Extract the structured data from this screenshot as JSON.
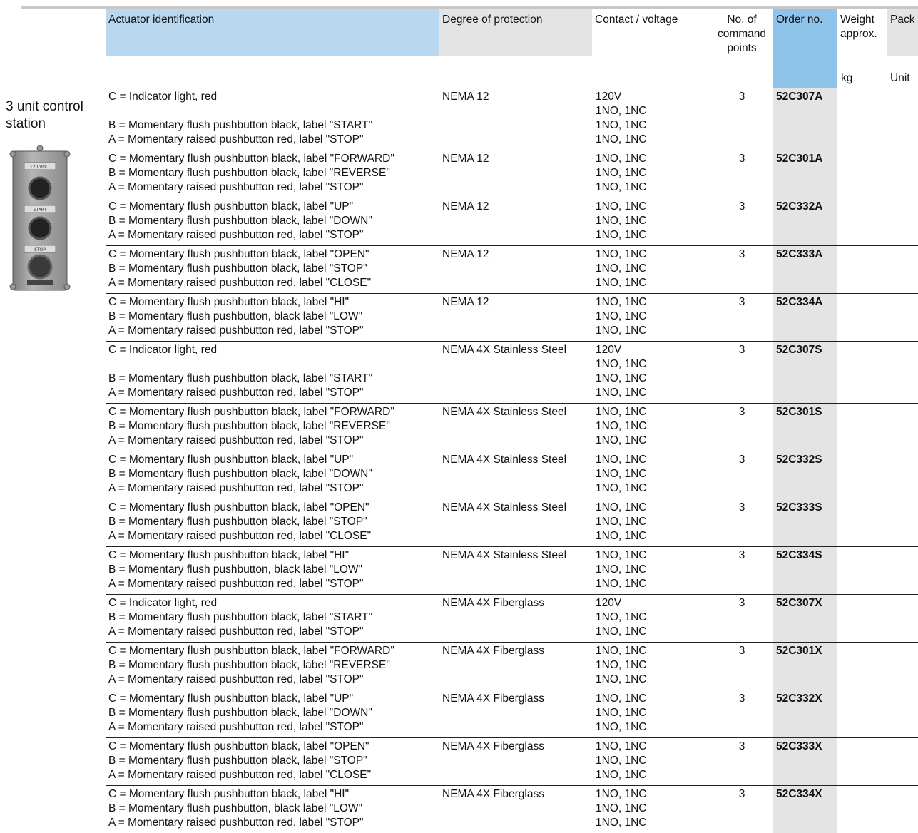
{
  "header": {
    "actuator": "Actuator identification",
    "degree": "Degree of protection",
    "contact": "Contact / voltage",
    "points": [
      "No. of",
      "command",
      "points"
    ],
    "order": "Order no.",
    "weight": [
      "Weight",
      "approx."
    ],
    "pack": "Pack",
    "kg": "kg",
    "unit": "Unit"
  },
  "section": {
    "title": [
      "3 unit control",
      "station"
    ],
    "image_name": "3-unit-control-station-photo",
    "device_labels": [
      "120 VOLT",
      "START",
      "STOP"
    ]
  },
  "rows": [
    {
      "actuator": [
        "C = Indicator light, red",
        "",
        "B = Momentary flush pushbutton black, label \"START\"",
        "A = Momentary raised pushbutton red, label \"STOP\""
      ],
      "degree": "NEMA 12",
      "contact": [
        "120V",
        "1NO, 1NC",
        "1NO, 1NC",
        "1NO, 1NC"
      ],
      "points": "3",
      "order": "52C307A"
    },
    {
      "actuator": [
        "C = Momentary flush pushbutton black, label \"FORWARD\"",
        "B = Momentary flush pushbutton black, label \"REVERSE\"",
        "A = Momentary raised pushbutton red, label \"STOP\""
      ],
      "degree": "NEMA 12",
      "contact": [
        "1NO, 1NC",
        "1NO, 1NC",
        "1NO, 1NC"
      ],
      "points": "3",
      "order": "52C301A"
    },
    {
      "actuator": [
        "C = Momentary flush pushbutton black, label \"UP\"",
        "B = Momentary flush pushbutton black, label \"DOWN\"",
        "A = Momentary raised pushbutton red, label \"STOP\""
      ],
      "degree": "NEMA 12",
      "contact": [
        "1NO, 1NC",
        "1NO, 1NC",
        "1NO, 1NC"
      ],
      "points": "3",
      "order": "52C332A"
    },
    {
      "actuator": [
        "C = Momentary flush pushbutton black, label \"OPEN\"",
        "B = Momentary flush pushbutton black, label \"STOP\"",
        "A = Momentary raised pushbutton red, label \"CLOSE\""
      ],
      "degree": "NEMA 12",
      "contact": [
        "1NO, 1NC",
        "1NO, 1NC",
        "1NO, 1NC"
      ],
      "points": "3",
      "order": "52C333A"
    },
    {
      "actuator": [
        "C = Momentary flush pushbutton black, label \"HI\"",
        "B = Momentary flush pushbutton, black label \"LOW\"",
        "A = Momentary raised pushbutton red, label \"STOP\""
      ],
      "degree": "NEMA 12",
      "contact": [
        "1NO, 1NC",
        "1NO, 1NC",
        "1NO, 1NC"
      ],
      "points": "3",
      "order": "52C334A"
    },
    {
      "actuator": [
        "C = Indicator light, red",
        "",
        "B = Momentary flush pushbutton black, label \"START\"",
        "A = Momentary raised pushbutton red, label \"STOP\""
      ],
      "degree": "NEMA 4X Stainless Steel",
      "contact": [
        "120V",
        "1NO, 1NC",
        "1NO, 1NC",
        "1NO, 1NC"
      ],
      "points": "3",
      "order": "52C307S"
    },
    {
      "actuator": [
        "C = Momentary flush pushbutton black, label \"FORWARD\"",
        "B = Momentary flush pushbutton black, label \"REVERSE\"",
        "A = Momentary raised pushbutton red, label \"STOP\""
      ],
      "degree": "NEMA 4X Stainless Steel",
      "contact": [
        "1NO, 1NC",
        "1NO, 1NC",
        "1NO, 1NC"
      ],
      "points": "3",
      "order": "52C301S"
    },
    {
      "actuator": [
        "C = Momentary flush pushbutton black, label \"UP\"",
        "B = Momentary flush pushbutton black, label \"DOWN\"",
        "A = Momentary raised pushbutton red, label \"STOP\""
      ],
      "degree": "NEMA 4X Stainless Steel",
      "contact": [
        "1NO, 1NC",
        "1NO, 1NC",
        "1NO, 1NC"
      ],
      "points": "3",
      "order": "52C332S"
    },
    {
      "actuator": [
        "C = Momentary flush pushbutton black, label \"OPEN\"",
        "B = Momentary flush pushbutton black, label \"STOP\"",
        "A = Momentary raised pushbutton red, label \"CLOSE\""
      ],
      "degree": "NEMA 4X Stainless Steel",
      "contact": [
        "1NO, 1NC",
        "1NO, 1NC",
        "1NO, 1NC"
      ],
      "points": "3",
      "order": "52C333S"
    },
    {
      "actuator": [
        "C = Momentary flush pushbutton black, label \"HI\"",
        "B = Momentary flush pushbutton, black label \"LOW\"",
        "A = Momentary raised pushbutton red, label \"STOP\""
      ],
      "degree": "NEMA 4X Stainless Steel",
      "contact": [
        "1NO, 1NC",
        "1NO, 1NC",
        "1NO, 1NC"
      ],
      "points": "3",
      "order": "52C334S"
    },
    {
      "actuator": [
        "C = Indicator light, red",
        "B = Momentary flush pushbutton black, label \"START\"",
        "A = Momentary raised pushbutton red, label \"STOP\""
      ],
      "degree": "NEMA 4X Fiberglass",
      "contact": [
        "120V",
        "1NO, 1NC",
        "1NO, 1NC"
      ],
      "points": "3",
      "order": "52C307X"
    },
    {
      "actuator": [
        "C = Momentary flush pushbutton black, label \"FORWARD\"",
        "B = Momentary flush pushbutton black, label \"REVERSE\"",
        "A = Momentary raised pushbutton red, label \"STOP\""
      ],
      "degree": "NEMA 4X Fiberglass",
      "contact": [
        "1NO, 1NC",
        "1NO, 1NC",
        "1NO, 1NC"
      ],
      "points": "3",
      "order": "52C301X"
    },
    {
      "actuator": [
        "C = Momentary flush pushbutton black, label \"UP\"",
        "B = Momentary flush pushbutton black, label \"DOWN\"",
        "A = Momentary raised pushbutton red, label \"STOP\""
      ],
      "degree": "NEMA 4X Fiberglass",
      "contact": [
        "1NO, 1NC",
        "1NO, 1NC",
        "1NO, 1NC"
      ],
      "points": "3",
      "order": "52C332X"
    },
    {
      "actuator": [
        "C = Momentary flush pushbutton black, label \"OPEN\"",
        "B = Momentary flush pushbutton black, label \"STOP\"",
        "A = Momentary raised pushbutton red, label \"CLOSE\""
      ],
      "degree": "NEMA 4X Fiberglass",
      "contact": [
        "1NO, 1NC",
        "1NO, 1NC",
        "1NO, 1NC"
      ],
      "points": "3",
      "order": "52C333X"
    },
    {
      "actuator": [
        "C = Momentary flush pushbutton black, label \"HI\"",
        "B = Momentary flush pushbutton, black label \"LOW\"",
        "A = Momentary raised pushbutton red, label \"STOP\""
      ],
      "degree": "NEMA 4X Fiberglass",
      "contact": [
        "1NO, 1NC",
        "1NO, 1NC",
        "1NO, 1NC"
      ],
      "points": "3",
      "order": "52C334X"
    }
  ]
}
